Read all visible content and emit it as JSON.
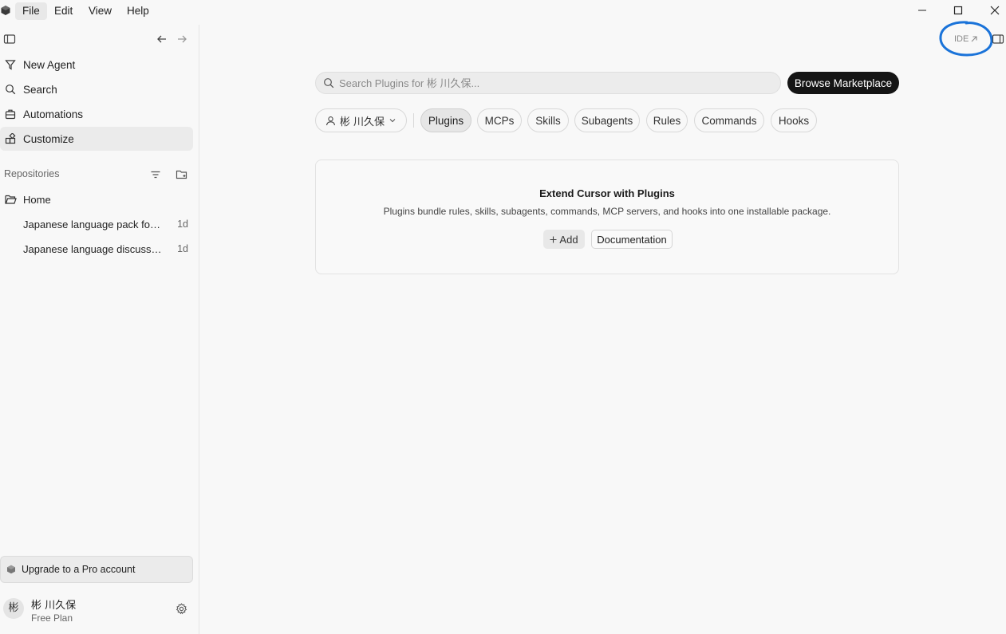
{
  "menu": {
    "file": "File",
    "edit": "Edit",
    "view": "View",
    "help": "Help"
  },
  "sidebar": {
    "nav": [
      {
        "label": "New Agent",
        "icon": "new-agent-icon"
      },
      {
        "label": "Search",
        "icon": "search-icon"
      },
      {
        "label": "Automations",
        "icon": "automations-icon"
      },
      {
        "label": "Customize",
        "icon": "customize-icon",
        "active": true
      }
    ],
    "repositories_label": "Repositories",
    "repos": [
      {
        "label": "Home"
      },
      {
        "label": "Japanese language pack for ...",
        "age": "1d"
      },
      {
        "label": "Japanese language discussion",
        "age": "1d"
      }
    ],
    "upgrade_label": "Upgrade to a Pro account",
    "user": {
      "avatar": "彬",
      "name": "彬 川久保",
      "plan": "Free Plan"
    }
  },
  "header": {
    "ide_label": "IDE"
  },
  "search": {
    "placeholder": "Search Plugins for 彬 川久保..."
  },
  "browse_label": "Browse Marketplace",
  "scope": {
    "label": "彬 川久保"
  },
  "tabs": [
    {
      "label": "Plugins",
      "active": true
    },
    {
      "label": "MCPs"
    },
    {
      "label": "Skills"
    },
    {
      "label": "Subagents"
    },
    {
      "label": "Rules"
    },
    {
      "label": "Commands"
    },
    {
      "label": "Hooks"
    }
  ],
  "card": {
    "title": "Extend Cursor with Plugins",
    "description": "Plugins bundle rules, skills, subagents, commands, MCP servers, and hooks into one installable package.",
    "add_label": "Add",
    "doc_label": "Documentation"
  },
  "colors": {
    "accent_dark": "#151515",
    "annotation_blue": "#1a73d9"
  }
}
